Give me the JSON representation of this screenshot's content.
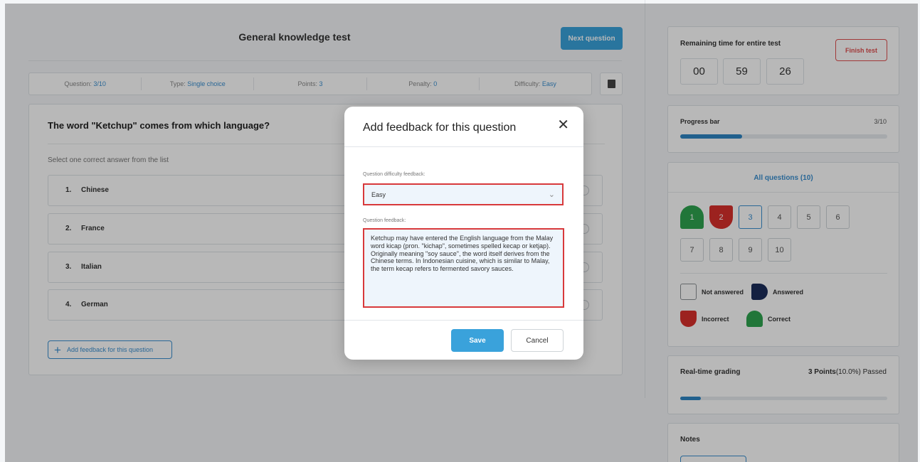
{
  "header": {
    "title": "General knowledge test",
    "next_button": "Next question"
  },
  "info_bar": [
    {
      "label": "Question: ",
      "value": "3/10"
    },
    {
      "label": "Type: ",
      "value": "Single choice"
    },
    {
      "label": "Points: ",
      "value": "3"
    },
    {
      "label": "Penalty: ",
      "value": "0"
    },
    {
      "label": "Difficulty: ",
      "value": "Easy"
    }
  ],
  "question": {
    "text": "The word \"Ketchup\" comes from which language?",
    "instruction": "Select one correct answer from the list",
    "answers": [
      {
        "num": "1.",
        "label": "Chinese"
      },
      {
        "num": "2.",
        "label": "France"
      },
      {
        "num": "3.",
        "label": "Italian"
      },
      {
        "num": "4.",
        "label": "German"
      }
    ],
    "feedback_button": "Add feedback for this question"
  },
  "timer": {
    "title": "Remaining time for entire test",
    "finish_button": "Finish test",
    "hours": "00",
    "minutes": "59",
    "seconds": "26"
  },
  "progress": {
    "title": "Progress bar",
    "count": "3/10",
    "fraction": 0.3
  },
  "all_questions": {
    "title": "All questions (10)",
    "items": [
      {
        "label": "1",
        "status": "correct"
      },
      {
        "label": "2",
        "status": "incorrect"
      },
      {
        "label": "3",
        "status": "current"
      },
      {
        "label": "4",
        "status": "not-answered"
      },
      {
        "label": "5",
        "status": "not-answered"
      },
      {
        "label": "6",
        "status": "not-answered"
      },
      {
        "label": "7",
        "status": "not-answered"
      },
      {
        "label": "8",
        "status": "not-answered"
      },
      {
        "label": "9",
        "status": "not-answered"
      },
      {
        "label": "10",
        "status": "not-answered"
      }
    ],
    "legend": {
      "not_answered": "Not answered",
      "answered": "Answered",
      "incorrect": "Incorrect",
      "correct": "Correct"
    }
  },
  "grading": {
    "title": "Real-time grading",
    "points": "3 Points",
    "percent_status": "(10.0%) Passed",
    "fraction": 0.1
  },
  "notes": {
    "title": "Notes"
  },
  "modal": {
    "title": "Add feedback for this question",
    "close": "✕",
    "difficulty_label": "Question difficulty feedback:",
    "difficulty_value": "Easy",
    "feedback_label": "Question feedback:",
    "feedback_text": "Ketchup may have entered the English language from the Malay word kicap (pron. \"kichap\", sometimes spelled kecap or ketjap). Originally meaning \"soy sauce\", the word itself derives from the Chinese terms. In Indonesian cuisine, which is similar to Malay, the term kecap refers to fermented savory sauces.",
    "save": "Save",
    "cancel": "Cancel"
  },
  "colors": {
    "accent": "#3aa2db",
    "link": "#3a8fd0",
    "correct": "#2ea44f",
    "incorrect": "#d9302c",
    "answered": "#1b2d5a",
    "error_border": "#d8393b"
  }
}
